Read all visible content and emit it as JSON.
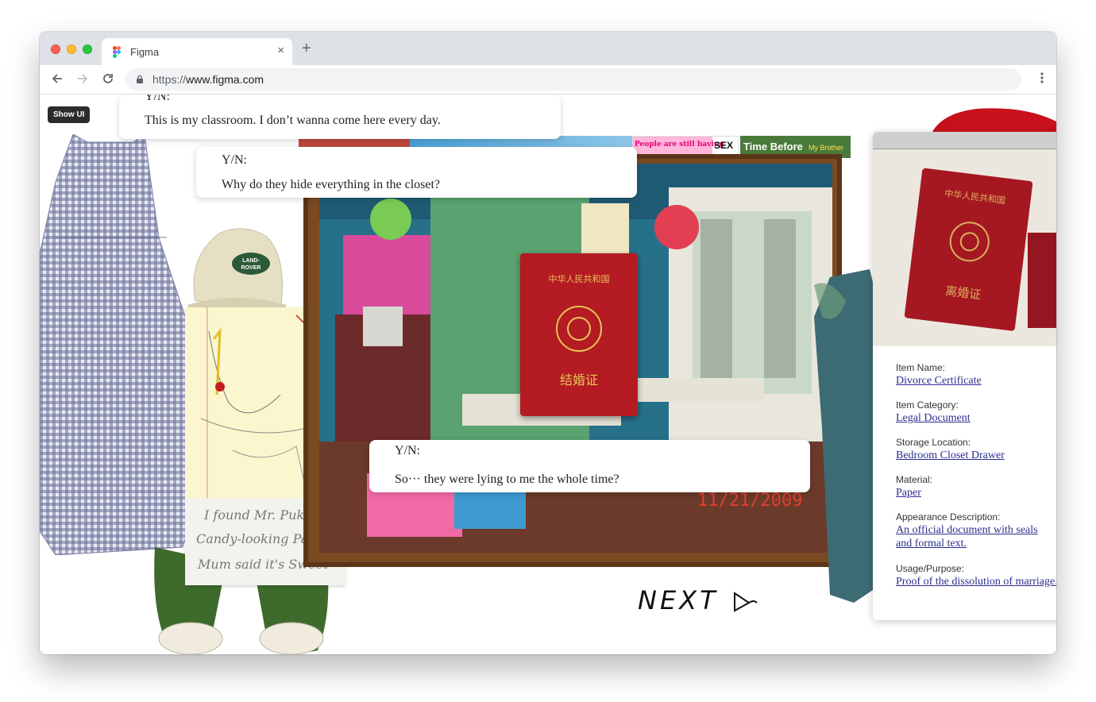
{
  "browser": {
    "tab_title": "Figma",
    "url_scheme": "https://",
    "url_host": "www.figma.com",
    "new_tab": "+",
    "tab_close": "×"
  },
  "figma": {
    "show_ui_label": "Show UI"
  },
  "banners": {
    "sex_small": "People are still having",
    "sex_big": "SEX",
    "time_before": "Time Before",
    "my_brother": "My Brother"
  },
  "photo": {
    "date": "11/21/2009"
  },
  "note": {
    "lines": [
      "I found Mr. Puker",
      "Candy-looking Pack",
      "Mum said it's Sweet"
    ]
  },
  "dialogues": [
    {
      "speaker": "Y/N:",
      "line": "This is my classroom. I don’t wanna come here every day."
    },
    {
      "speaker": "Y/N:",
      "line": "Why do they hide everything in the closet?"
    },
    {
      "speaker": "Y/N:",
      "line": "So··· they were lying to me the whole time?"
    }
  ],
  "next_label": "NEXT",
  "item": {
    "name_label": "Item Name:",
    "name": "Divorce Certificate",
    "category_label": "Item Category:",
    "category": "Legal Document",
    "storage_label": "Storage Location:",
    "storage": "Bedroom Closet Drawer",
    "material_label": "Material:",
    "material": "Paper",
    "appearance_label": "Appearance Description:",
    "appearance_1": "An official document with seals",
    "appearance_2": "and formal text.",
    "usage_label": "Usage/Purpose:",
    "usage": "Proof of the dissolution of marriage."
  },
  "colors": {
    "link": "#2b2d8e",
    "certificate_red": "#b41b22",
    "tab_bar": "#dee1e6"
  },
  "icons": [
    "figma-icon",
    "back-arrow-icon",
    "forward-arrow-icon",
    "reload-icon",
    "lock-icon",
    "kebab-menu-icon"
  ]
}
